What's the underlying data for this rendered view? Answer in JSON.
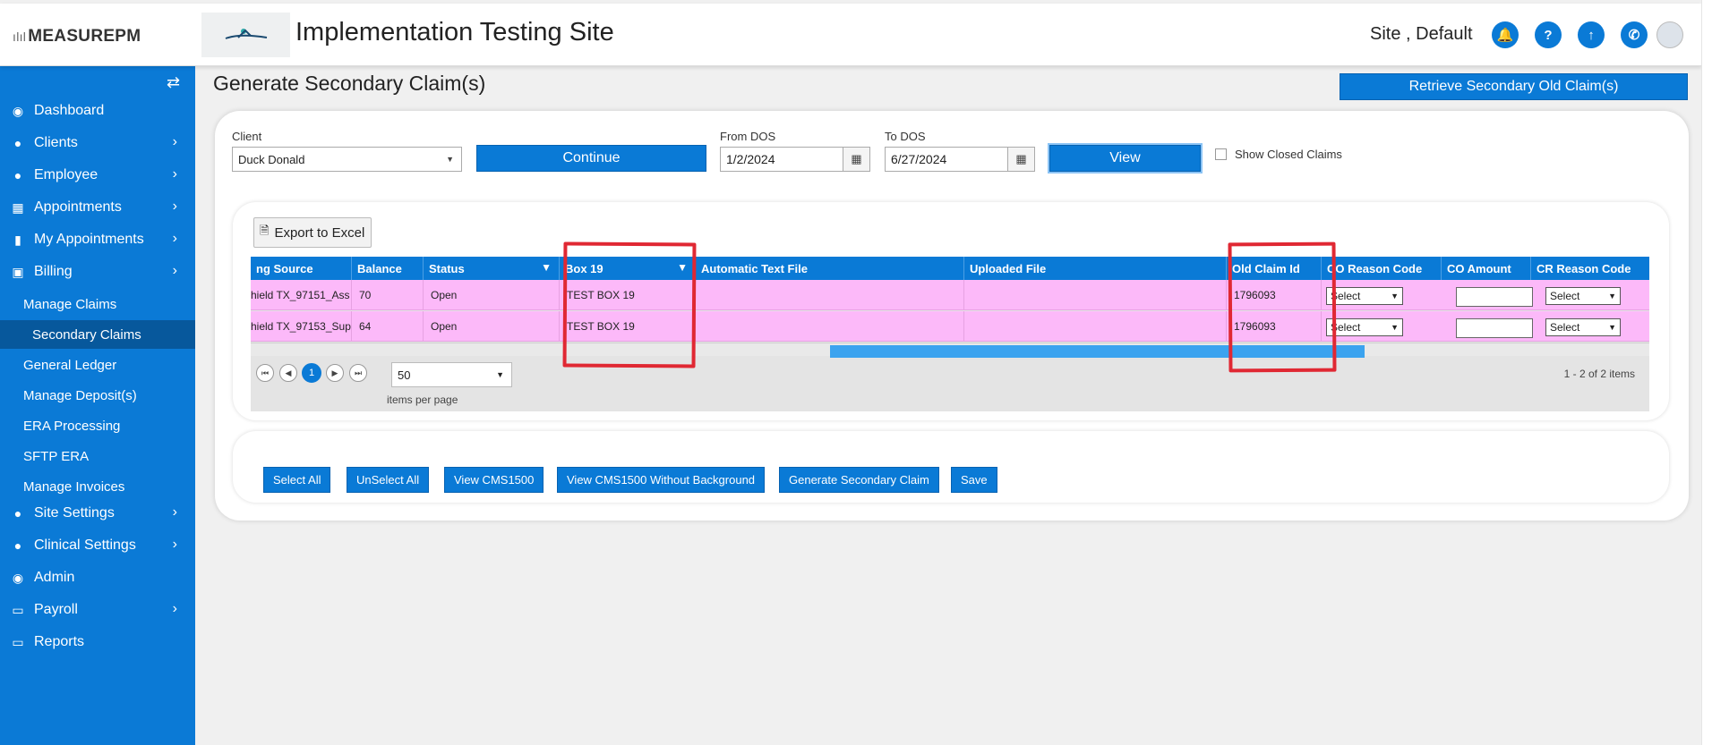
{
  "header": {
    "brand": "MEASUREPM",
    "site_title": "Implementation Testing Site",
    "user_name": "Site , Default",
    "icons": [
      "bell-icon",
      "help-icon",
      "upload-icon",
      "phone-icon",
      "user-avatar-icon"
    ]
  },
  "sidebar": {
    "items": [
      {
        "label": "Dashboard",
        "icon": "dashboard-icon"
      },
      {
        "label": "Clients",
        "icon": "user-icon"
      },
      {
        "label": "Employee",
        "icon": "users-icon"
      },
      {
        "label": "Appointments",
        "icon": "calendar-icon"
      },
      {
        "label": "My Appointments",
        "icon": "book-icon"
      },
      {
        "label": "Billing",
        "icon": "money-icon"
      }
    ],
    "billing_sub": [
      "Manage Claims",
      "Secondary Claims",
      "General Ledger",
      "Manage Deposit(s)",
      "ERA Processing",
      "SFTP ERA",
      "Manage Invoices"
    ],
    "active_sub": "Secondary Claims",
    "bottom_items": [
      {
        "label": "Site Settings",
        "icon": "user-icon"
      },
      {
        "label": "Clinical Settings",
        "icon": "user-icon"
      },
      {
        "label": "Admin",
        "icon": "admin-icon"
      },
      {
        "label": "Payroll",
        "icon": "card-icon"
      },
      {
        "label": "Reports",
        "icon": "report-icon"
      }
    ]
  },
  "page": {
    "heading": "Generate Secondary Claim(s)",
    "retrieve_label": "Retrieve Secondary Old Claim(s)"
  },
  "filters": {
    "client_label": "Client",
    "client_value": "Duck Donald",
    "continue_label": "Continue",
    "from_label": "From DOS",
    "from_value": "1/2/2024",
    "to_label": "To DOS",
    "to_value": "6/27/2024",
    "view_label": "View",
    "show_closed_label": "Show Closed Claims"
  },
  "grid": {
    "export_label": "Export to Excel",
    "columns": [
      "ng Source",
      "Balance",
      "Status",
      "Box 19",
      "Automatic Text File",
      "Uploaded File",
      "Old Claim Id",
      "CO Reason Code",
      "CO Amount",
      "CR Reason Code"
    ],
    "rows": [
      {
        "source": "hield TX_97151_Ass",
        "balance": "70",
        "status": "Open",
        "box19": "TEST BOX 19",
        "auto_text": "",
        "uploaded": "",
        "old_claim_id": "1796093",
        "co_reason": "Select",
        "co_amount": "",
        "cr_reason": "Select"
      },
      {
        "source": "hield TX_97153_Sup",
        "balance": "64",
        "status": "Open",
        "box19": "TEST BOX 19",
        "auto_text": "",
        "uploaded": "",
        "old_claim_id": "1796093",
        "co_reason": "Select",
        "co_amount": "",
        "cr_reason": "Select"
      }
    ],
    "row_highlight": "#fcb9f9",
    "header_color": "#0a7ad6",
    "current_page": "1",
    "page_size": "50",
    "items_per_page_label": "items per page",
    "range_label": "1 - 2 of 2 items"
  },
  "actions": [
    "Select All",
    "UnSelect All",
    "View CMS1500",
    "View CMS1500 Without Background",
    "Generate Secondary Claim",
    "Save"
  ],
  "colors": {
    "accent": "#0a7ad6",
    "sidebar": "#0b7ad6",
    "sidebar_active": "#07589c",
    "highlight_box": "#e02833"
  }
}
